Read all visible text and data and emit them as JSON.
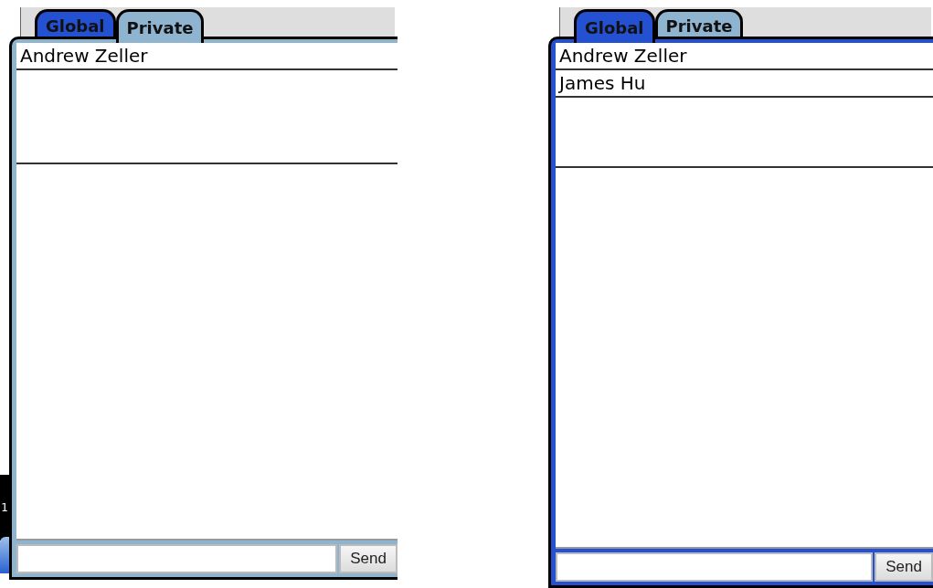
{
  "edge_fragment": {
    "text": "1"
  },
  "panels": [
    {
      "tabs": [
        {
          "label": "Global",
          "selected": false,
          "color": "#2450d2"
        },
        {
          "label": "Private",
          "selected": true,
          "color": "#8fb4d0"
        }
      ],
      "users": [
        "Andrew Zeller"
      ],
      "send_label": "Send"
    },
    {
      "tabs": [
        {
          "label": "Global",
          "selected": true,
          "color": "#2450d2"
        },
        {
          "label": "Private",
          "selected": false,
          "color": "#8fb4d0"
        }
      ],
      "users": [
        "Andrew Zeller",
        "James Hu"
      ],
      "send_label": "Send"
    }
  ]
}
